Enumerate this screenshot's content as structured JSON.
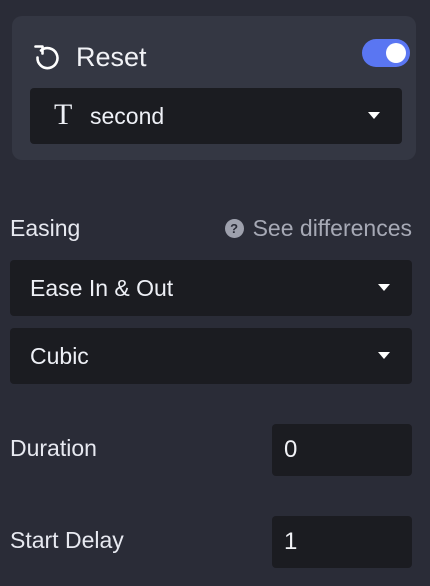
{
  "layer": {
    "reset_label": "Reset",
    "reset_icon": "reset-icon",
    "toggle_enabled": true,
    "accent_color": "#5a76f2",
    "type_icon": "text-layer-icon",
    "type_glyph": "T",
    "selected": "second"
  },
  "easing": {
    "label": "Easing",
    "help_link": "See differences",
    "type_selected": "Ease In & Out",
    "curve_selected": "Cubic"
  },
  "timing": {
    "duration_label": "Duration",
    "duration_value": "0",
    "delay_label": "Start Delay",
    "delay_value": "1"
  }
}
